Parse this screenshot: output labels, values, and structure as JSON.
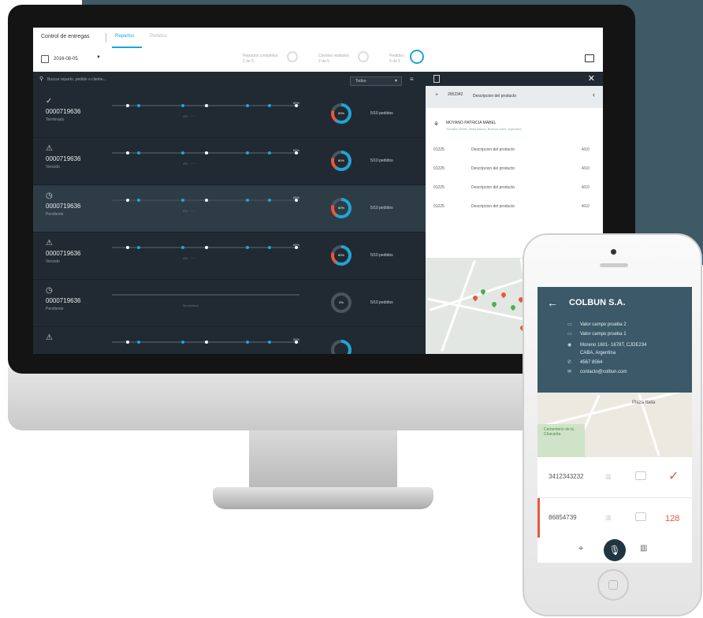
{
  "desktop": {
    "header": {
      "title": "Control de entregas",
      "tabs": [
        "Repartos",
        "Pedidos"
      ],
      "date": "2016-08-05",
      "stats": [
        {
          "label": "Repartos completos",
          "value": "2 de 5"
        },
        {
          "label": "Clientes visitados",
          "value": "2 de 5"
        },
        {
          "label": "Pedidos",
          "value": "5 de 5"
        }
      ]
    },
    "search": {
      "placeholder": "Buscar reparto, pedido o cliente...",
      "filter": "Todos"
    },
    "rows": [
      {
        "icon": "✓",
        "id": "0000719636",
        "status": "Terminado",
        "pct": "65%",
        "donut": "80%",
        "pedidos": "5/10 pedidos",
        "mid": "4% ·······"
      },
      {
        "icon": "⚠",
        "id": "0000719636",
        "status": "Vencido",
        "pct": "65%",
        "donut": "80%",
        "pedidos": "5/10 pedidos",
        "mid": "4% ·······"
      },
      {
        "icon": "◷",
        "id": "0000719636",
        "status": "Pendiente",
        "pct": "65%",
        "donut": "80%",
        "pedidos": "5/10 pedidos",
        "mid": "4% ·······"
      },
      {
        "icon": "⚠",
        "id": "0000719636",
        "status": "Vencido",
        "pct": "65%",
        "donut": "80%",
        "pedidos": "5/10 pedidos",
        "mid": "4% ·······"
      },
      {
        "icon": "◷",
        "id": "0000719636",
        "status": "Pendiente",
        "pct": "",
        "donut": "0%",
        "pedidos": "5/10 pedidos",
        "mid": "No iniciado"
      },
      {
        "icon": "⚠",
        "id": "",
        "status": "",
        "pct": "65%",
        "donut": "",
        "pedidos": "",
        "mid": ""
      }
    ],
    "side": {
      "product_code": "2652342",
      "product_desc": "Descripcion del producto",
      "client_name": "MOYANO PATRICIA MABEL",
      "client_addr": "Gorriban White, Bella Banca, Buenos Aires, Argentina",
      "lines": [
        {
          "code": "01225",
          "desc": "Descripcion del producto",
          "qty": "4/10"
        },
        {
          "code": "01225",
          "desc": "Descripcion del producto",
          "qty": "4/10"
        },
        {
          "code": "01225",
          "desc": "Descripcion del producto",
          "qty": "4/10"
        },
        {
          "code": "01225",
          "desc": "Descripcion del producto",
          "qty": "4/10"
        }
      ]
    }
  },
  "phone": {
    "title": "COLBUN S.A.",
    "info": [
      {
        "icon": "▭",
        "text": "Valor campo prueba 2"
      },
      {
        "icon": "▭",
        "text": "Valor campo prueba 1"
      },
      {
        "icon": "◉",
        "text": "Moreno 1601- 1678T, CJDE234"
      },
      {
        "icon": "",
        "text": "CABA, Argentina"
      },
      {
        "icon": "✆",
        "text": "4567 8564"
      },
      {
        "icon": "✉",
        "text": "contacto@colbun.com"
      }
    ],
    "map_labels": [
      "Plaza Italia",
      "Cementerio de la Chacarita"
    ],
    "rows": [
      {
        "number": "3412343232",
        "state": "✓"
      },
      {
        "number": "86854739",
        "count": "128"
      }
    ]
  },
  "colors": {
    "accent": "#1fa5d6",
    "alert": "#e9573f",
    "dark": "#212a32",
    "panel": "#3f5966"
  }
}
